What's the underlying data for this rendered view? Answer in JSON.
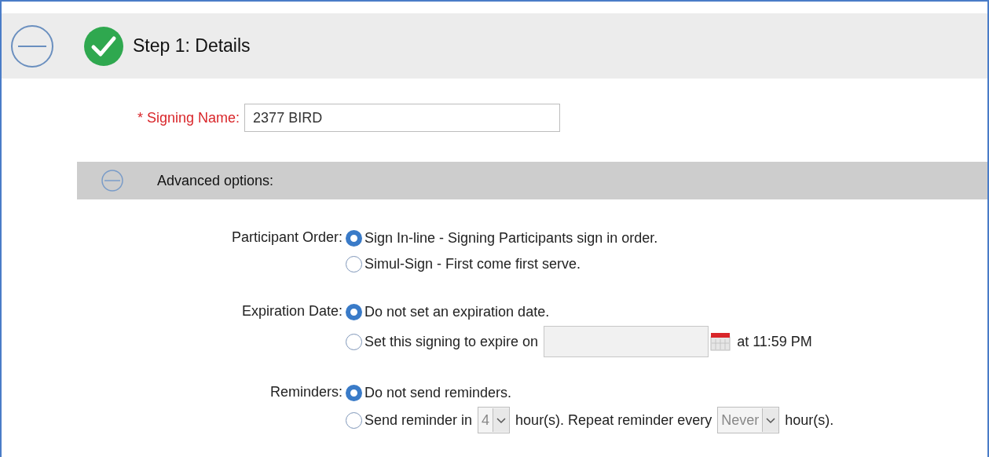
{
  "step": {
    "title": "Step 1: Details",
    "completed": true
  },
  "signing_name": {
    "required_mark": "*",
    "label": "Signing Name:",
    "value": "2377 BIRD"
  },
  "advanced": {
    "title": "Advanced options:"
  },
  "options": [
    {
      "label": "Participant Order:",
      "choices": [
        {
          "selected": true,
          "parts": [
            {
              "kind": "text",
              "text": "Sign In-line - Signing Participants sign in order."
            }
          ]
        },
        {
          "selected": false,
          "parts": [
            {
              "kind": "text",
              "text": "Simul-Sign - First come first serve."
            }
          ]
        }
      ]
    },
    {
      "label": "Expiration Date:",
      "choices": [
        {
          "selected": true,
          "parts": [
            {
              "kind": "text",
              "text": "Do not set an expiration date."
            }
          ]
        },
        {
          "selected": false,
          "parts": [
            {
              "kind": "text",
              "text": "Set this signing to expire on"
            },
            {
              "kind": "date"
            },
            {
              "kind": "text",
              "text": "at 11:59 PM"
            }
          ]
        }
      ]
    },
    {
      "label": "Reminders:",
      "choices": [
        {
          "selected": true,
          "parts": [
            {
              "kind": "text",
              "text": "Do not send reminders."
            }
          ]
        },
        {
          "selected": false,
          "parts": [
            {
              "kind": "text",
              "text": "Send reminder in"
            },
            {
              "kind": "select",
              "value": "4"
            },
            {
              "kind": "text",
              "text": "hour(s). Repeat reminder every"
            },
            {
              "kind": "select",
              "value": "Never"
            },
            {
              "kind": "text",
              "text": "hour(s)."
            }
          ]
        }
      ]
    }
  ]
}
